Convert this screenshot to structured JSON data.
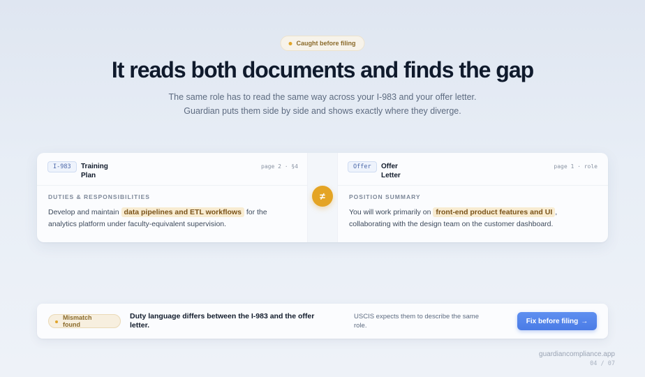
{
  "badge": {
    "label": "Caught before filing"
  },
  "headline": "It reads both documents and finds the gap",
  "subtitle": {
    "line1": "The same role has to read the same way across your I-983 and your offer letter.",
    "line2": "Guardian puts them side by side and shows exactly where they diverge."
  },
  "left": {
    "tag": "I-983",
    "title_line1": "Training",
    "title_line2": "Plan",
    "ref": "page 2 · §4",
    "section": "DUTIES & RESPONSIBILITIES",
    "text_before": "Develop and maintain",
    "highlight": "data pipelines and ETL workflows",
    "text_after": "for the",
    "text_line2": "analytics platform under faculty-equivalent supervision."
  },
  "compare_symbol": "≠",
  "right": {
    "tag": "Offer",
    "title_line1": "Offer",
    "title_line2": "Letter",
    "ref": "page 1 · role",
    "section": "POSITION SUMMARY",
    "text_before": "You will work primarily on",
    "highlight": "front-end product features and UI",
    "text_after": ",",
    "text_line2": "collaborating with the design team on the customer dashboard."
  },
  "alert": {
    "badge_line1": "Mismatch",
    "badge_line2": "found",
    "title_line1": "Duty language differs between the I-983 and the offer",
    "title_line2": "letter.",
    "note_line1": "USCIS expects them to describe the same",
    "note_line2": "role.",
    "button_label": "Fix before filing",
    "button_arrow": "→"
  },
  "footer": {
    "site": "guardiancompliance.app",
    "pager": "04 / 07"
  },
  "colors": {
    "accent_amber": "#e4a424",
    "highlight_bg": "#f8ecd2",
    "button_blue": "#4a7be6"
  }
}
